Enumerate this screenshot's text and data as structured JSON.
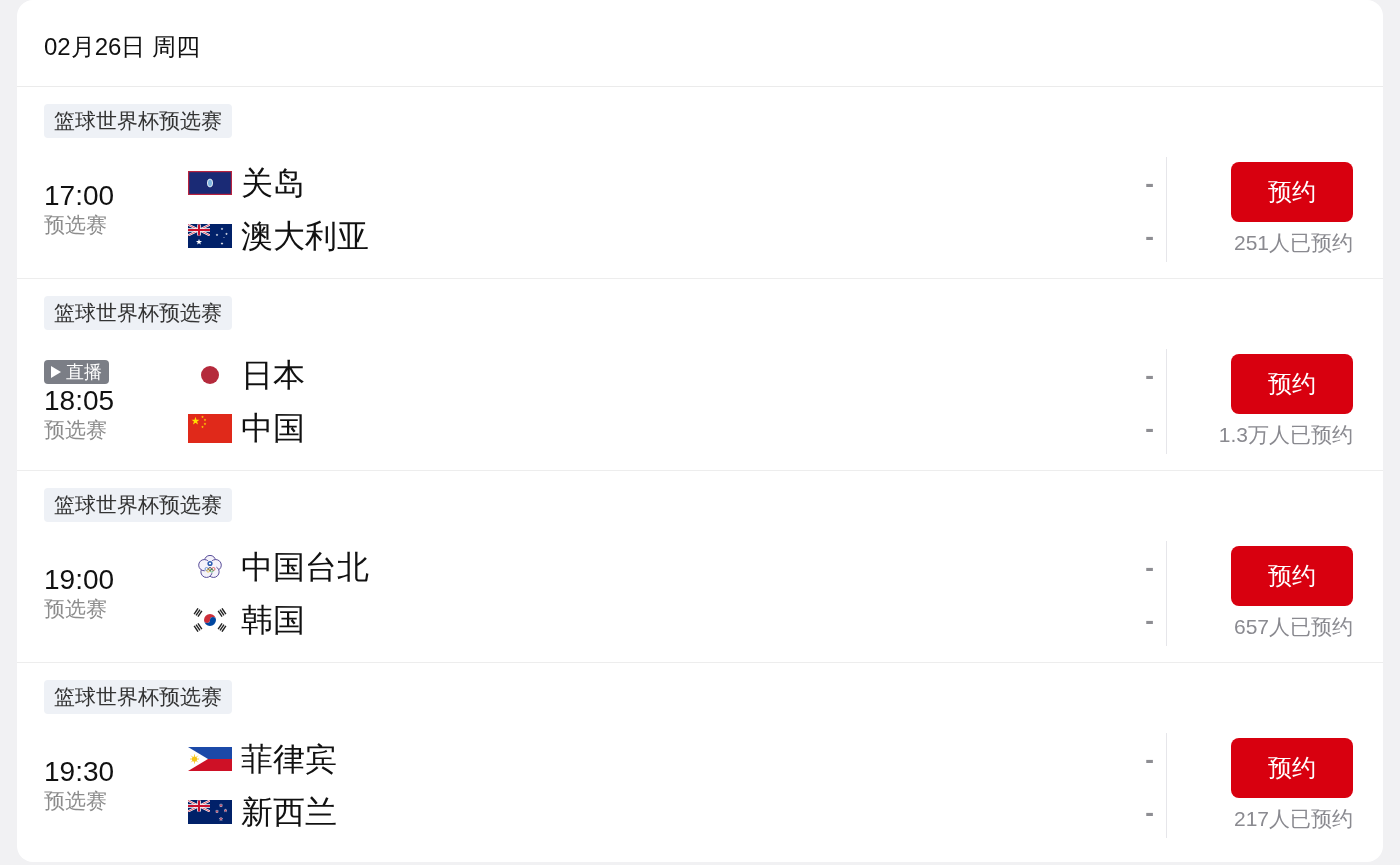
{
  "date_header": "02月26日 周四",
  "matches": [
    {
      "competition": "篮球世界杯预选赛",
      "time": "17:00",
      "stage": "预选赛",
      "teams": [
        {
          "name": "关岛",
          "score": "-"
        },
        {
          "name": "澳大利亚",
          "score": "-"
        }
      ],
      "reserve_button": "预约",
      "reservation_count": "251人已预约"
    },
    {
      "competition": "篮球世界杯预选赛",
      "live_badge": "直播",
      "time": "18:05",
      "stage": "预选赛",
      "teams": [
        {
          "name": "日本",
          "score": "-"
        },
        {
          "name": "中国",
          "score": "-"
        }
      ],
      "reserve_button": "预约",
      "reservation_count": "1.3万人已预约"
    },
    {
      "competition": "篮球世界杯预选赛",
      "time": "19:00",
      "stage": "预选赛",
      "teams": [
        {
          "name": "中国台北",
          "score": "-"
        },
        {
          "name": "韩国",
          "score": "-"
        }
      ],
      "reserve_button": "预约",
      "reservation_count": "657人已预约"
    },
    {
      "competition": "篮球世界杯预选赛",
      "time": "19:30",
      "stage": "预选赛",
      "teams": [
        {
          "name": "菲律宾",
          "score": "-"
        },
        {
          "name": "新西兰",
          "score": "-"
        }
      ],
      "reserve_button": "预约",
      "reservation_count": "217人已预约"
    }
  ]
}
